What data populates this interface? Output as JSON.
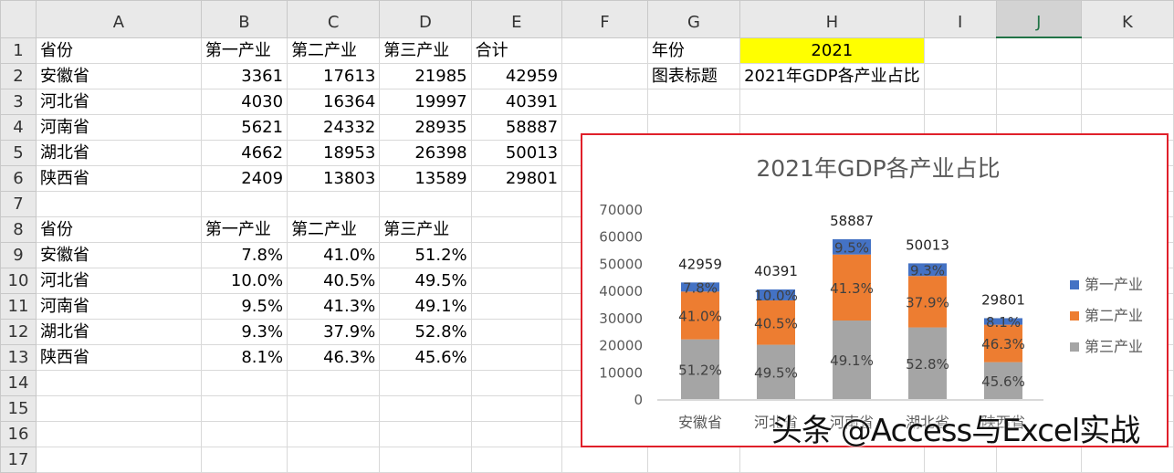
{
  "columns": [
    "A",
    "B",
    "C",
    "D",
    "E",
    "F",
    "G",
    "H",
    "I",
    "J",
    "K"
  ],
  "selected_column": "J",
  "rows": [
    [
      "省份",
      "第一产业",
      "第二产业",
      "第三产业",
      "合计",
      "",
      "年份",
      "2021",
      "",
      "",
      ""
    ],
    [
      "安徽省",
      "3361",
      "17613",
      "21985",
      "42959",
      "",
      "图表标题",
      "2021年GDP各产业占比",
      "",
      "",
      ""
    ],
    [
      "河北省",
      "4030",
      "16364",
      "19997",
      "40391",
      "",
      "",
      "",
      "",
      "",
      ""
    ],
    [
      "河南省",
      "5621",
      "24332",
      "28935",
      "58887",
      "",
      "",
      "",
      "",
      "",
      ""
    ],
    [
      "湖北省",
      "4662",
      "18953",
      "26398",
      "50013",
      "",
      "",
      "",
      "",
      "",
      ""
    ],
    [
      "陕西省",
      "2409",
      "13803",
      "13589",
      "29801",
      "",
      "",
      "",
      "",
      "",
      ""
    ],
    [
      "",
      "",
      "",
      "",
      "",
      "",
      "",
      "",
      "",
      "",
      ""
    ],
    [
      "省份",
      "第一产业",
      "第二产业",
      "第三产业",
      "",
      "",
      "",
      "",
      "",
      "",
      ""
    ],
    [
      "安徽省",
      "7.8%",
      "41.0%",
      "51.2%",
      "",
      "",
      "",
      "",
      "",
      "",
      ""
    ],
    [
      "河北省",
      "10.0%",
      "40.5%",
      "49.5%",
      "",
      "",
      "",
      "",
      "",
      "",
      ""
    ],
    [
      "河南省",
      "9.5%",
      "41.3%",
      "49.1%",
      "",
      "",
      "",
      "",
      "",
      "",
      ""
    ],
    [
      "湖北省",
      "9.3%",
      "37.9%",
      "52.8%",
      "",
      "",
      "",
      "",
      "",
      "",
      ""
    ],
    [
      "陕西省",
      "8.1%",
      "46.3%",
      "45.6%",
      "",
      "",
      "",
      "",
      "",
      "",
      ""
    ],
    [
      "",
      "",
      "",
      "",
      "",
      "",
      "",
      "",
      "",
      "",
      ""
    ],
    [
      "",
      "",
      "",
      "",
      "",
      "",
      "",
      "",
      "",
      "",
      ""
    ],
    [
      "",
      "",
      "",
      "",
      "",
      "",
      "",
      "",
      "",
      "",
      ""
    ],
    [
      "",
      "",
      "",
      "",
      "",
      "",
      "",
      "",
      "",
      "",
      ""
    ]
  ],
  "chart_data": {
    "type": "bar",
    "stacked": true,
    "title": "2021年GDP各产业占比",
    "categories": [
      "安徽省",
      "河北省",
      "河南省",
      "湖北省",
      "陕西省"
    ],
    "series": [
      {
        "name": "第一产业",
        "color": "#4472c4",
        "values": [
          3361,
          4030,
          5621,
          4662,
          2409
        ],
        "labels": [
          "7.8%",
          "10.0%",
          "9.5%",
          "9.3%",
          "8.1%"
        ]
      },
      {
        "name": "第二产业",
        "color": "#ed7d31",
        "values": [
          17613,
          16364,
          24332,
          18953,
          13803
        ],
        "labels": [
          "41.0%",
          "40.5%",
          "41.3%",
          "37.9%",
          "46.3%"
        ]
      },
      {
        "name": "第三产业",
        "color": "#a5a5a5",
        "values": [
          21985,
          19997,
          28935,
          26398,
          13589
        ],
        "labels": [
          "51.2%",
          "49.5%",
          "49.1%",
          "52.8%",
          "45.6%"
        ]
      }
    ],
    "totals": [
      "42959",
      "40391",
      "58887",
      "50013",
      "29801"
    ],
    "yticks": [
      "0",
      "10000",
      "20000",
      "30000",
      "40000",
      "50000",
      "60000",
      "70000"
    ],
    "ylim": [
      0,
      70000
    ],
    "legend": "right"
  },
  "watermark": "头条 @Access与Excel实战"
}
